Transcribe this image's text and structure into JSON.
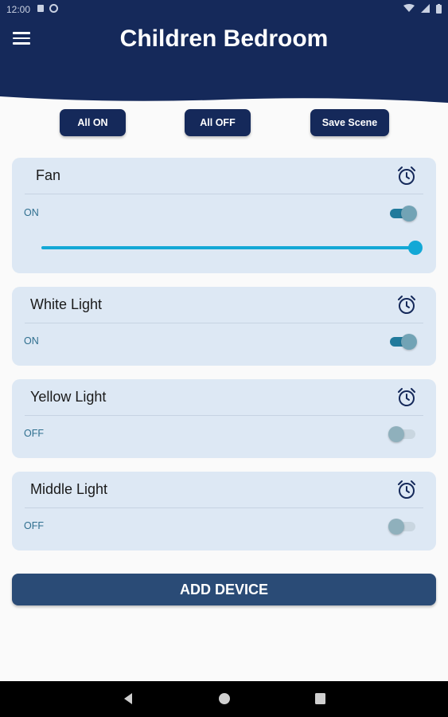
{
  "status": {
    "time": "12:00"
  },
  "header": {
    "title": "Children Bedroom",
    "menu_icon": "menu-icon"
  },
  "actions": {
    "all_on": "All ON",
    "all_off": "All OFF",
    "save_scene": "Save Scene"
  },
  "colors": {
    "primary": "#15295a",
    "card": "#dde8f4",
    "accent": "#13a8d6",
    "button": "#2a4b76"
  },
  "devices": [
    {
      "name": "Fan",
      "state": "ON",
      "on": true,
      "level": 1.0,
      "has_slider": true
    },
    {
      "name": "White Light",
      "state": "ON",
      "on": true
    },
    {
      "name": "Yellow Light",
      "state": "OFF",
      "on": false
    },
    {
      "name": "Middle Light",
      "state": "OFF",
      "on": false
    }
  ],
  "add_device_label": "ADD DEVICE",
  "nav": {
    "back": "back-icon",
    "home": "home-icon",
    "recents": "recents-icon"
  }
}
